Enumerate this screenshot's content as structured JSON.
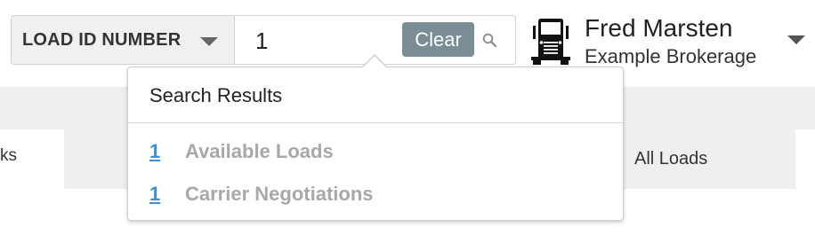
{
  "search": {
    "type_label": "LOAD ID NUMBER",
    "value": "1",
    "clear_label": "Clear"
  },
  "user": {
    "name": "Fred Marsten",
    "company": "Example Brokerage"
  },
  "background_tabs": {
    "left_partial": "ks",
    "right": "All Loads"
  },
  "results": {
    "title": "Search Results",
    "items": [
      {
        "count": "1",
        "label": "Available Loads"
      },
      {
        "count": "1",
        "label": "Carrier Negotiations"
      }
    ]
  },
  "icons": {
    "type_caret": "chevron-down-icon",
    "search": "search-icon",
    "truck": "truck-icon",
    "user_caret": "chevron-down-icon"
  },
  "colors": {
    "clear_button": "#7a8c94",
    "link": "#3b8fd6",
    "muted_text": "#a8a8a8",
    "band": "#eeeeee"
  }
}
